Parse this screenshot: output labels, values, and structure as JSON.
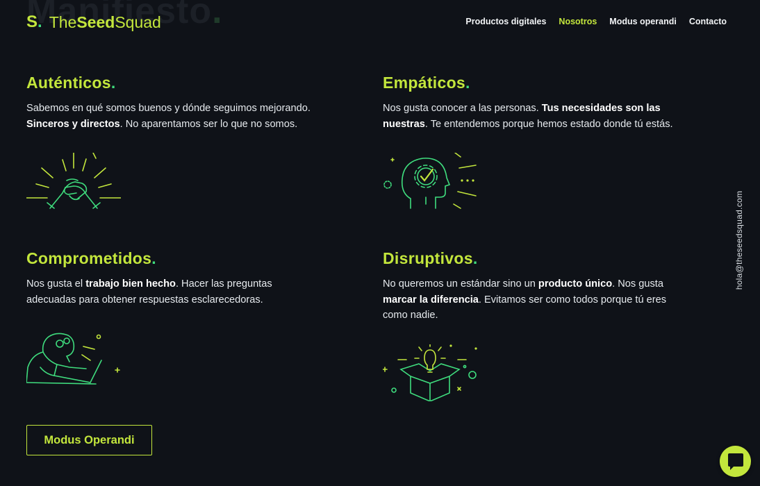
{
  "header": {
    "ghost_title": "Manifiesto",
    "logo": {
      "mark": "S",
      "brand_pre": "The",
      "brand_bold": "Seed",
      "brand_post": "Squad"
    },
    "nav": [
      {
        "label": "Productos digitales",
        "active": false
      },
      {
        "label": "Nosotros",
        "active": true
      },
      {
        "label": "Modus operandi",
        "active": false
      },
      {
        "label": "Contacto",
        "active": false
      }
    ]
  },
  "values": [
    {
      "title": "Auténticos",
      "body": [
        {
          "t": "Sabemos en qué somos buenos y dónde seguimos mejorando. "
        },
        {
          "t": "Sinceros y directos",
          "b": true
        },
        {
          "t": ". No aparentamos ser lo que no somos."
        }
      ],
      "icon": "handshake-icon"
    },
    {
      "title": "Empáticos",
      "body": [
        {
          "t": "Nos gusta conocer a las personas. "
        },
        {
          "t": "Tus necesidades son las nuestras",
          "b": true
        },
        {
          "t": ". Te entendemos porque hemos estado donde tú estás."
        }
      ],
      "icon": "head-gear-check-icon"
    },
    {
      "title": "Comprometidos",
      "body": [
        {
          "t": "Nos gusta el "
        },
        {
          "t": "trabajo bien hecho",
          "b": true
        },
        {
          "t": ". Hacer las preguntas adecuadas para obtener respuestas esclarecedoras."
        }
      ],
      "icon": "person-laptop-icon"
    },
    {
      "title": "Disruptivos",
      "body": [
        {
          "t": "No queremos un estándar sino un "
        },
        {
          "t": "producto único",
          "b": true
        },
        {
          "t": ". Nos gusta "
        },
        {
          "t": "marcar la diferencia",
          "b": true
        },
        {
          "t": ". Evitamos ser como todos porque tú eres como nadie."
        }
      ],
      "icon": "lightbulb-box-icon"
    }
  ],
  "title_dot": ".",
  "cta_label": "Modus Operandi",
  "side_email": "hola@theseedsquad.com",
  "colors": {
    "accent": "#c3e63c",
    "green": "#3fdd7e",
    "background": "#0f1218"
  },
  "chat_icon": "chat-bubble-icon"
}
